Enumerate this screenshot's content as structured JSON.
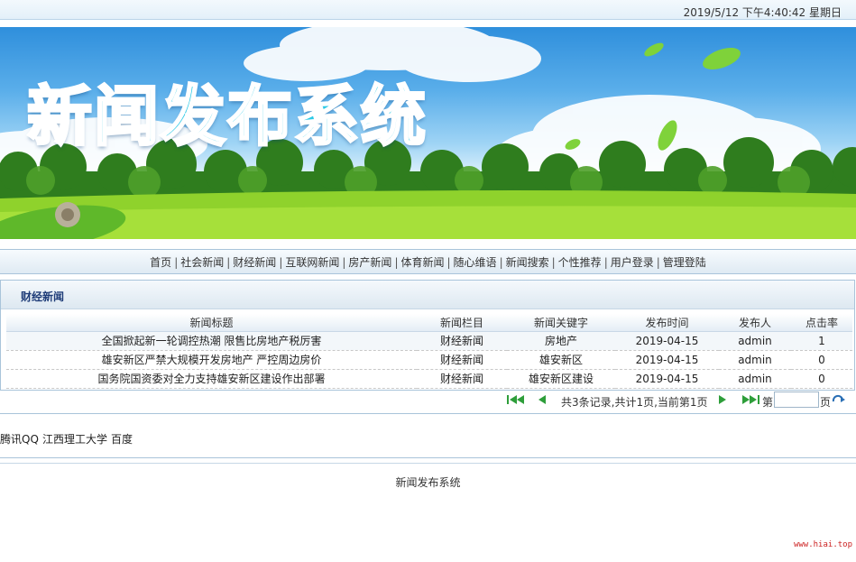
{
  "header": {
    "datetime": "2019/5/12 下午4:40:42  星期日"
  },
  "banner": {
    "title": "新闻发布系统"
  },
  "nav": {
    "items": [
      "首页",
      "社会新闻",
      "财经新闻",
      "互联网新闻",
      "房产新闻",
      "体育新闻",
      "随心维语",
      "新闻搜索",
      "个性推荐",
      "用户登录",
      "管理登陆"
    ]
  },
  "panel": {
    "title": "财经新闻"
  },
  "table": {
    "headers": [
      "新闻标题",
      "新闻栏目",
      "新闻关键字",
      "发布时间",
      "发布人",
      "点击率"
    ],
    "rows": [
      [
        "全国掀起新一轮调控热潮 限售比房地产税厉害",
        "财经新闻",
        "房地产",
        "2019-04-15",
        "admin",
        "1"
      ],
      [
        "雄安新区严禁大规模开发房地产 严控周边房价",
        "财经新闻",
        "雄安新区",
        "2019-04-15",
        "admin",
        "0"
      ],
      [
        "国务院国资委对全力支持雄安新区建设作出部署",
        "财经新闻",
        "雄安新区建设",
        "2019-04-15",
        "admin",
        "0"
      ]
    ]
  },
  "pager": {
    "info": "共3条记录,共计1页,当前第1页",
    "goto_prefix": "第",
    "goto_suffix": "页",
    "page_value": ""
  },
  "links": {
    "items": [
      "腾讯QQ",
      "江西理工大学",
      "百度"
    ]
  },
  "footer": {
    "text": "新闻发布系统"
  },
  "watermark": {
    "text": "www.hiai.top"
  },
  "colors": {
    "accent": "#2cc9e6",
    "pager_icon": "#2e9e3a",
    "panel_title": "#1e3c78"
  }
}
